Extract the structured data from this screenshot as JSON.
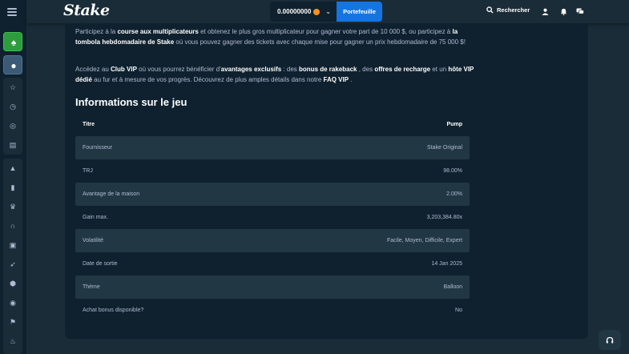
{
  "header": {
    "logo": "Stake",
    "balance": "0.00000000",
    "wallet_label": "Portefeuille",
    "search_label": "Rechercher"
  },
  "content": {
    "p1_pre": "Participez à la ",
    "p1_b1": "course aux multiplicateurs",
    "p1_mid1": " et obtenez le plus gros multiplicateur pour gagner votre part de 10 000 $, ou participez à ",
    "p1_b2": "la tombola hebdomadaire de Stake",
    "p1_post": " où vous pouvez gagner des tickets avec chaque mise pour gagner un prix hebdomadaire de 75 000 $!",
    "p2_pre": "Accédez au ",
    "p2_b1": "Club VIP",
    "p2_mid1": " où vous pourrez bénéficier d'",
    "p2_b2": "avantages exclusifs",
    "p2_mid2": " : des ",
    "p2_b3": "bonus de rakeback",
    "p2_mid3": " , des ",
    "p2_b4": "offres de recharge",
    "p2_mid4": " et un ",
    "p2_b5": "hôte VIP dédié",
    "p2_mid5": " au fur et à mesure de vos progrès. Découvrez de plus amples détails dans notre ",
    "p2_b6": "FAQ VIP",
    "p2_post": " .",
    "section_title": "Informations sur le jeu"
  },
  "table": {
    "header": {
      "key": "Titre",
      "value": "Pump"
    },
    "rows": [
      {
        "key": "Fournisseur",
        "value": "Stake Original"
      },
      {
        "key": "TRJ",
        "value": "98.00%"
      },
      {
        "key": "Avantage de la maison",
        "value": "2.00%"
      },
      {
        "key": "Gain max.",
        "value": "3,203,384.80x"
      },
      {
        "key": "Volatilité",
        "value": "Facile, Moyen, Difficile, Expert"
      },
      {
        "key": "Date de sortie",
        "value": "14 Jan 2025"
      },
      {
        "key": "Thème",
        "value": "Balloon"
      },
      {
        "key": "Achat bonus disponible?",
        "value": "No"
      }
    ]
  },
  "icons": {
    "sidebar": [
      "menu-icon",
      "star-icon",
      "history-icon",
      "target-icon",
      "calendar-icon",
      "fire-icon",
      "bookmark-icon",
      "crown-icon",
      "headset-icon",
      "gift-icon",
      "rocket-icon",
      "shield-icon",
      "globe-icon",
      "flag-icon",
      "flame-icon"
    ],
    "topbar": [
      "search-icon",
      "user-icon",
      "bell-icon",
      "chat-icon"
    ]
  },
  "colors": {
    "accent": "#1475e1",
    "background": "#1a2c38",
    "panel": "#0f212e",
    "row_alt": "#213743",
    "coin": "#f7931a"
  }
}
